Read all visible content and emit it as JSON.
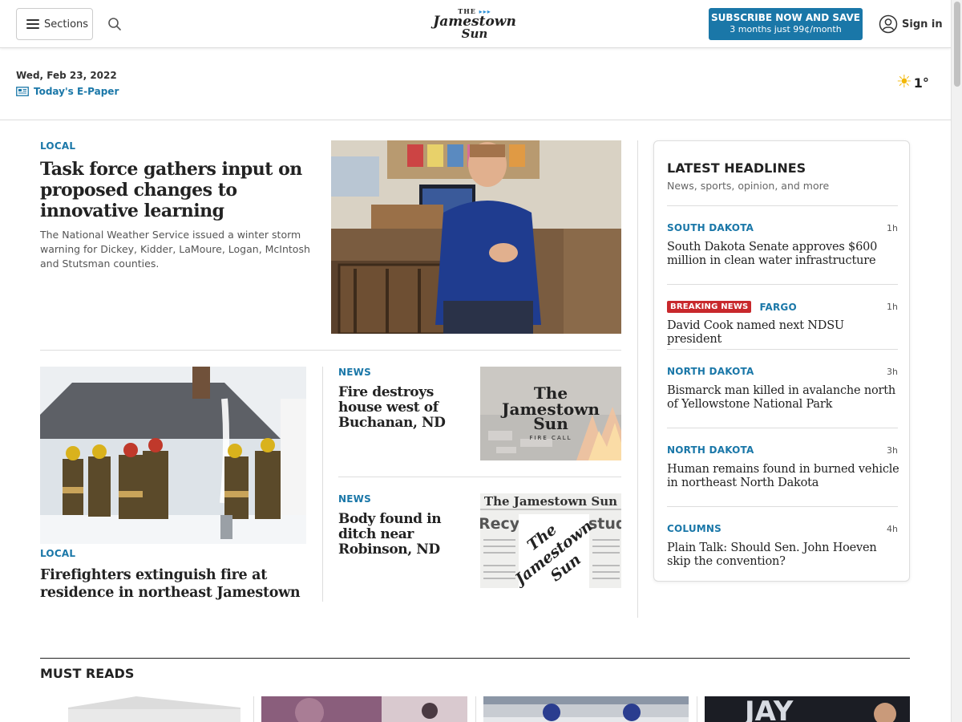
{
  "header": {
    "sections_label": "Sections",
    "logo": {
      "the": "THE",
      "line1": "Jamestown",
      "line2": "Sun"
    },
    "subscribe": {
      "line1": "SUBSCRIBE NOW AND SAVE",
      "line2": "3 months just 99¢/month"
    },
    "signin_label": "Sign in",
    "colors": {
      "accent": "#1a77a8",
      "breaking": "#c8282c"
    }
  },
  "datebar": {
    "date": "Wed, Feb 23, 2022",
    "epaper_label": "Today's E-Paper",
    "temperature": "1°"
  },
  "lead": {
    "kicker": "LOCAL",
    "headline": "Task force gathers input on proposed changes to innovative learning",
    "dek": "The National Weather Service issued a winter storm warning for Dickey, Kidder, LaMoure, Logan, McIntosh and Stutsman counties."
  },
  "feature": {
    "kicker": "LOCAL",
    "headline": "Firefighters extinguish fire at residence in northeast Jamestown"
  },
  "stories": [
    {
      "kicker": "NEWS",
      "headline": "Fire destroys house west of Buchanan, ND",
      "photo_logo": {
        "line1": "The",
        "line2": "Jamestown",
        "line3": "Sun",
        "tag": "FIRE CALL"
      }
    },
    {
      "kicker": "NEWS",
      "headline": "Body found in ditch near Robinson, ND",
      "photo_logo": {
        "masthead": "The Jamestown Sun",
        "line1": "The",
        "line2": "Jamestown",
        "line3": "Sun",
        "frag1": "Recycl",
        "frag2": "studi"
      }
    }
  ],
  "latest": {
    "title": "LATEST HEADLINES",
    "subtitle": "News, sports, opinion, and more",
    "items": [
      {
        "badge": "",
        "kicker": "SOUTH DAKOTA",
        "time": "1h",
        "headline": "South Dakota Senate approves $600 million in clean water infrastructure"
      },
      {
        "badge": "BREAKING NEWS",
        "kicker": "FARGO",
        "time": "1h",
        "headline": "David Cook named next NDSU president"
      },
      {
        "badge": "",
        "kicker": "NORTH DAKOTA",
        "time": "3h",
        "headline": "Bismarck man killed in avalanche north of Yellowstone National Park"
      },
      {
        "badge": "",
        "kicker": "NORTH DAKOTA",
        "time": "3h",
        "headline": "Human remains found in burned vehicle in northeast North Dakota"
      },
      {
        "badge": "",
        "kicker": "COLUMNS",
        "time": "4h",
        "headline": "Plain Talk: Should Sen. John Hoeven skip the convention?"
      }
    ]
  },
  "must_reads": {
    "title": "MUST READS",
    "card3_text": "JAY"
  }
}
